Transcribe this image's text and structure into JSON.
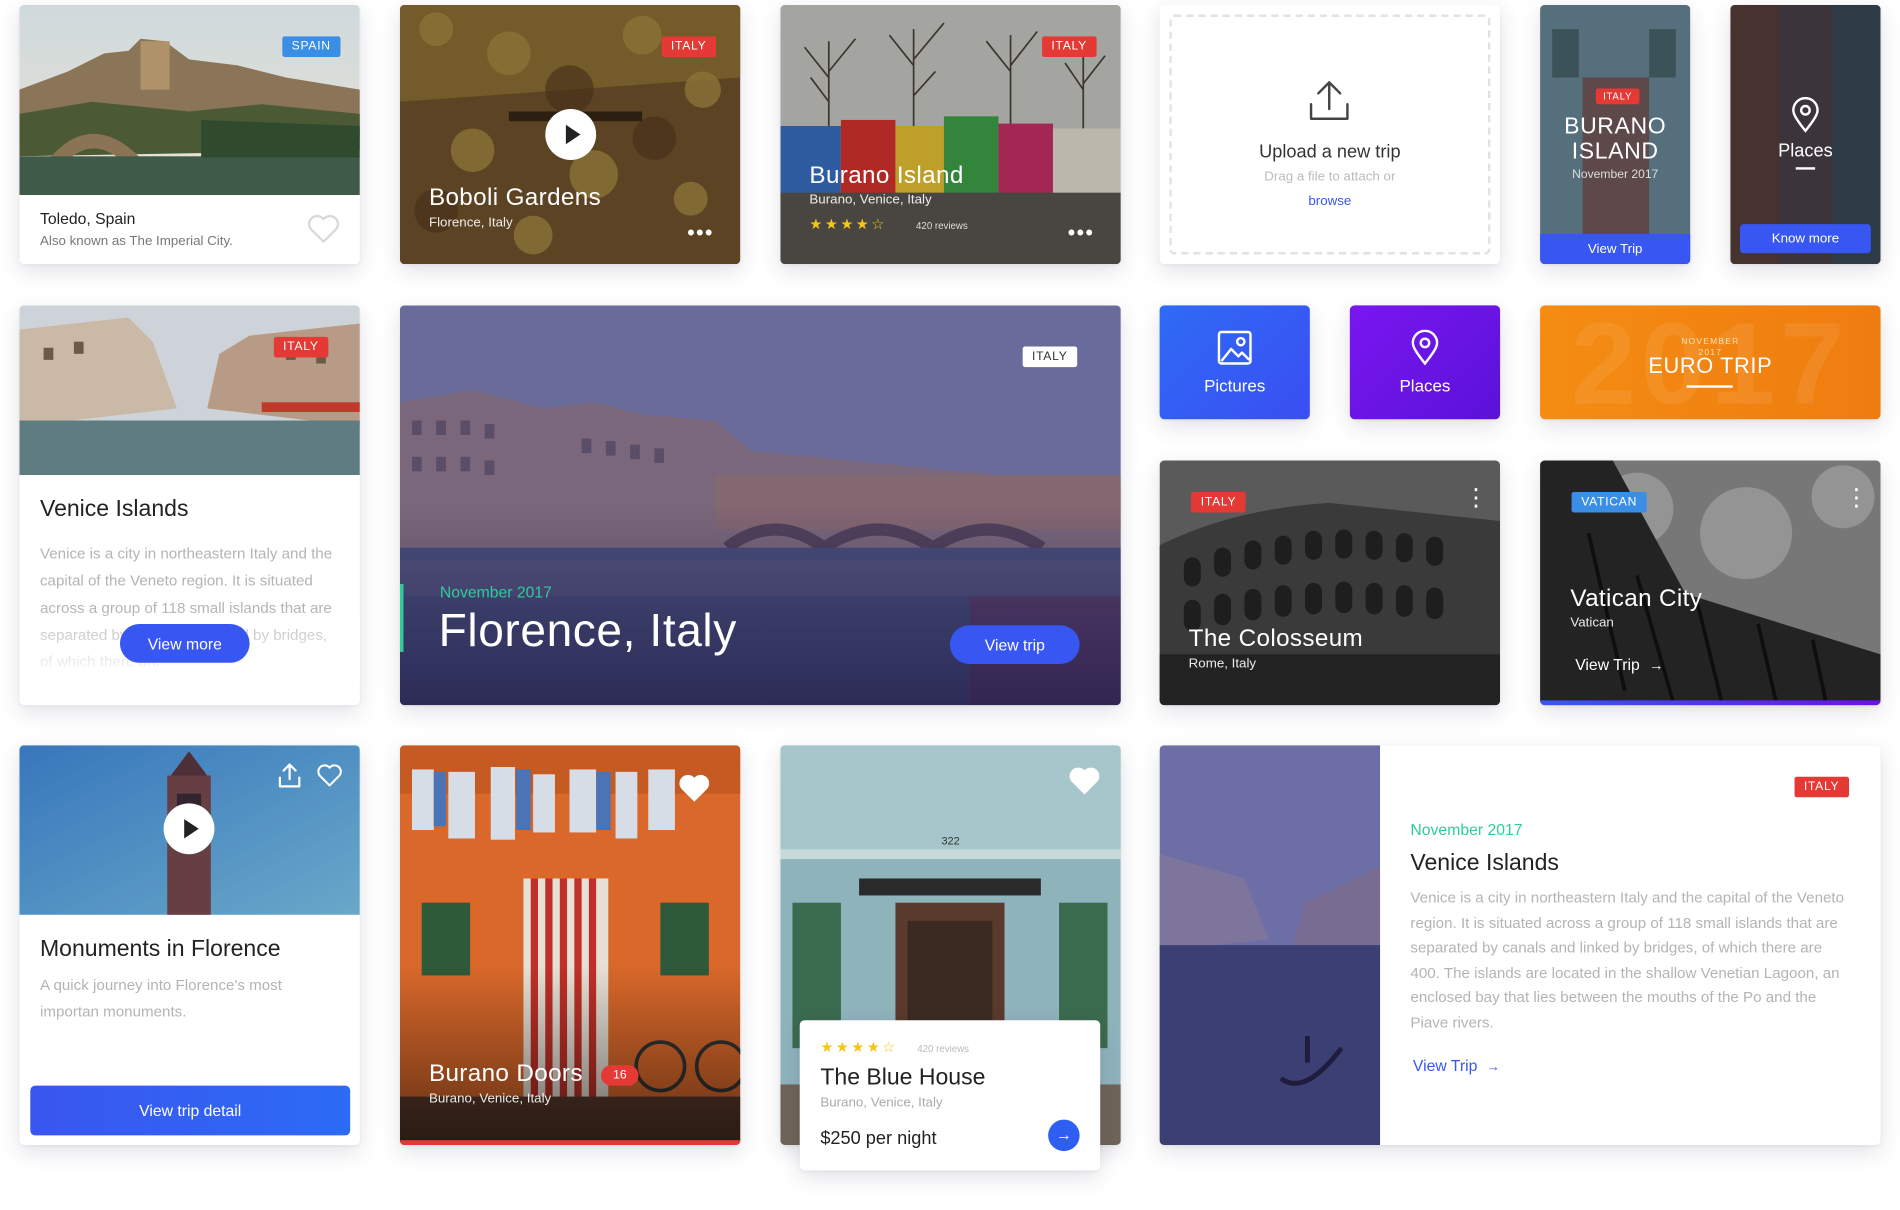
{
  "toledo": {
    "tag": "SPAIN",
    "title": "Toledo, Spain",
    "subtitle": "Also known as The Imperial City."
  },
  "boboli": {
    "tag": "ITALY",
    "title": "Boboli Gardens",
    "subtitle": "Florence, Italy",
    "more": "•••"
  },
  "burano_island": {
    "tag": "ITALY",
    "title": "Burano Island",
    "subtitle": "Burano, Venice, Italy",
    "stars": "★★★★☆",
    "reviews": "420 reviews",
    "more": "•••"
  },
  "upload": {
    "title": "Upload a new trip",
    "hint": "Drag a file to attach or",
    "link": "browse"
  },
  "burano_tall": {
    "tag": "ITALY",
    "title_line1": "BURANO",
    "title_line2": "ISLAND",
    "date": "November 2017",
    "button": "View Trip"
  },
  "places_tall": {
    "title": "Places",
    "button": "Know more"
  },
  "venice_card": {
    "tag": "ITALY",
    "title": "Venice Islands",
    "body": "Venice is a city in northeastern Italy and the capital of the Veneto region. It is situated across a group of 118 small islands that are separated by canals and linked by bridges, of which there are",
    "button": "View more"
  },
  "florence": {
    "tag": "ITALY",
    "date": "November 2017",
    "title": "Florence, Italy",
    "button": "View trip"
  },
  "pictures_tile": {
    "label": "Pictures"
  },
  "places_tile": {
    "label": "Places"
  },
  "euro_trip": {
    "month": "NOVEMBER",
    "year": "2017",
    "title": "EURO TRIP"
  },
  "colosseum": {
    "tag": "ITALY",
    "title": "The Colosseum",
    "subtitle": "Rome, Italy",
    "more": "⋮"
  },
  "vatican": {
    "tag": "VATICAN",
    "title": "Vatican City",
    "subtitle": "Vatican",
    "link": "View Trip",
    "more": "⋮"
  },
  "monuments": {
    "title": "Monuments in Florence",
    "body": "A quick journey into Florence's most importan monuments.",
    "button": "View trip detail"
  },
  "burano_doors": {
    "title": "Burano Doors",
    "badge": "16",
    "subtitle": "Burano, Venice, Italy"
  },
  "blue_house": {
    "stars": "★★★★☆",
    "reviews": "420 reviews",
    "title": "The Blue House",
    "subtitle": "Burano, Venice, Italy",
    "price": "$250 per night",
    "house_number": "322"
  },
  "venice_feature": {
    "tag": "ITALY",
    "date": "November 2017",
    "title": "Venice Islands",
    "body": "Venice is a city in northeastern Italy and the capital of the Veneto region. It is situated across a group of 118 small islands that are separated by canals and linked by bridges, of which there are 400. The islands are located in the shallow Venetian Lagoon, an enclosed bay that lies between the mouths of the Po and the Piave rivers.",
    "link": "View Trip"
  },
  "colors": {
    "accent_blue": "#3856f2",
    "tag_red": "#e53935",
    "tag_blue": "#3a8ee6",
    "green_date": "#2ecc9a",
    "orange": "#f48c12",
    "purple": "#6b12ea"
  }
}
